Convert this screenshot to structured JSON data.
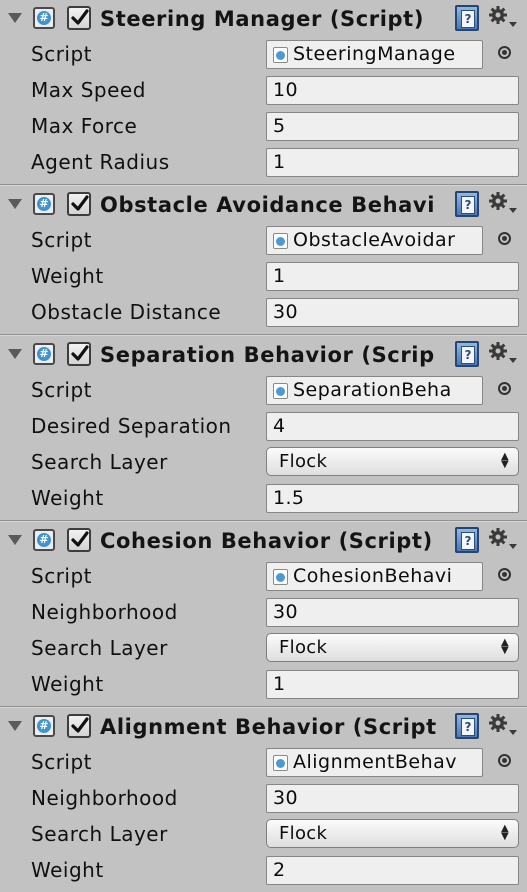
{
  "components": [
    {
      "title": "Steering Manager (Script)",
      "rows": [
        {
          "label": "Script",
          "type": "object",
          "value": "SteeringManage"
        },
        {
          "label": "Max Speed",
          "type": "text",
          "value": "10"
        },
        {
          "label": "Max Force",
          "type": "text",
          "value": "5"
        },
        {
          "label": "Agent Radius",
          "type": "text",
          "value": "1"
        }
      ]
    },
    {
      "title": "Obstacle Avoidance Behavi",
      "rows": [
        {
          "label": "Script",
          "type": "object",
          "value": "ObstacleAvoidar"
        },
        {
          "label": "Weight",
          "type": "text",
          "value": "1"
        },
        {
          "label": "Obstacle Distance",
          "type": "text",
          "value": "30"
        }
      ]
    },
    {
      "title": "Separation Behavior (Scrip",
      "rows": [
        {
          "label": "Script",
          "type": "object",
          "value": "SeparationBeha"
        },
        {
          "label": "Desired Separation",
          "type": "text",
          "value": "4"
        },
        {
          "label": "Search Layer",
          "type": "dropdown",
          "value": "Flock"
        },
        {
          "label": "Weight",
          "type": "text",
          "value": "1.5"
        }
      ]
    },
    {
      "title": "Cohesion Behavior (Script)",
      "rows": [
        {
          "label": "Script",
          "type": "object",
          "value": "CohesionBehavi"
        },
        {
          "label": "Neighborhood",
          "type": "text",
          "value": "30"
        },
        {
          "label": "Search Layer",
          "type": "dropdown",
          "value": "Flock"
        },
        {
          "label": "Weight",
          "type": "text",
          "value": "1"
        }
      ]
    },
    {
      "title": "Alignment Behavior (Script",
      "rows": [
        {
          "label": "Script",
          "type": "object",
          "value": "AlignmentBehav"
        },
        {
          "label": "Neighborhood",
          "type": "text",
          "value": "30"
        },
        {
          "label": "Search Layer",
          "type": "dropdown",
          "value": "Flock"
        },
        {
          "label": "Weight",
          "type": "text",
          "value": "2"
        }
      ]
    }
  ],
  "icons": {
    "foldout": "foldout-arrow-icon",
    "script": "script-icon",
    "enabled": "enabled-checkbox",
    "help": "help-book-icon",
    "settings": "gear-icon",
    "object_picker": "object-picker-icon",
    "dropdown": "updown-arrows-icon"
  },
  "colors": {
    "background": "#c2c2c2",
    "field": "#efefef",
    "script_icon": "#3c95d4"
  }
}
